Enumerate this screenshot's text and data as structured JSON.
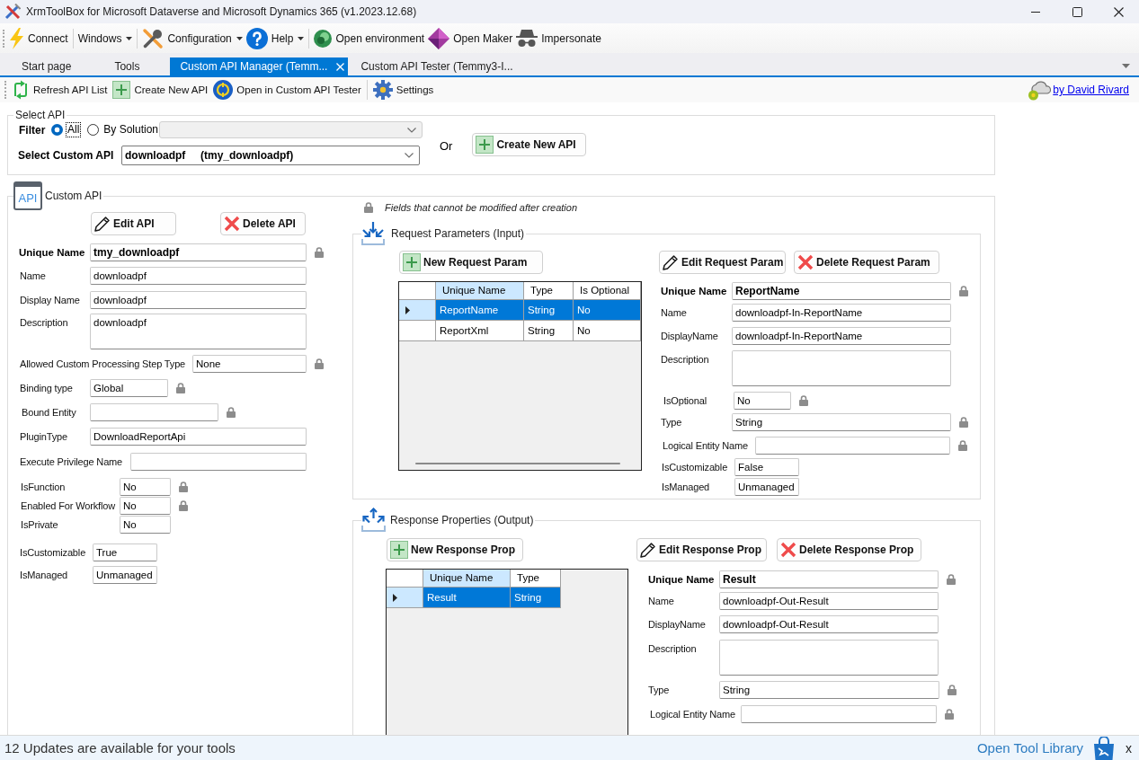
{
  "window": {
    "title": "XrmToolBox for Microsoft Dataverse and Microsoft Dynamics 365 (v1.2023.12.68)"
  },
  "main_toolbar": {
    "groups": [
      {
        "items": [
          {
            "label": "Connect",
            "dropdown": false
          }
        ]
      },
      {
        "items": [
          {
            "label": "Windows",
            "dropdown": true
          }
        ]
      },
      {
        "items": [
          {
            "label": "Configuration",
            "dropdown": true
          },
          {
            "label": "Help",
            "dropdown": true
          }
        ]
      },
      {
        "items": [
          {
            "label": "Open environment",
            "dropdown": false
          },
          {
            "label": "Open Maker",
            "dropdown": false
          },
          {
            "label": "Impersonate",
            "dropdown": false
          }
        ]
      }
    ]
  },
  "tabs": [
    {
      "label": "Start page",
      "selected": false
    },
    {
      "label": "Tools",
      "selected": false
    },
    {
      "label": "Custom API Manager (Temm...",
      "selected": true
    },
    {
      "label": "Custom API Tester (Temmy3-I...",
      "selected": false
    }
  ],
  "tool_toolbar": {
    "groups": [
      {
        "items": [
          {
            "label": "Refresh API List"
          },
          {
            "label": "Create New API"
          },
          {
            "label": "Open in Custom API Tester"
          }
        ]
      },
      {
        "items": [
          {
            "label": "Settings"
          }
        ]
      }
    ],
    "author_link": "by David Rivard"
  },
  "select_api": {
    "title": "Select API",
    "filter_label": "Filter",
    "filter_options": [
      {
        "label": "All",
        "selected": true,
        "focused": true
      },
      {
        "label": "By Solution",
        "selected": false,
        "focused": false
      }
    ],
    "solution_dropdown": {
      "disabled": true
    },
    "custom_api_label": "Select Custom API",
    "custom_api_value": "downloadpf     (tmy_downloadpf)",
    "or_label": "Or",
    "create_button": "Create New API"
  },
  "custom_api": {
    "title": "Custom API",
    "icon_label": "API",
    "edit_button": "Edit API",
    "delete_button": "Delete API",
    "fields": [
      {
        "label": "Unique Name",
        "value": "tmy_downloadpf",
        "kind": "key",
        "locked": true
      },
      {
        "label": "Name",
        "value": "downloadpf",
        "kind": "text",
        "locked": false
      },
      {
        "label": "Display Name",
        "value": "downloadpf",
        "kind": "text",
        "locked": false
      },
      {
        "label": "Description",
        "value": "downloadpf",
        "kind": "multiline",
        "locked": false
      },
      {
        "label": "Allowed Custom Processing Step Type",
        "value": "None",
        "kind": "text",
        "locked": true
      },
      {
        "label": "Binding type",
        "value": "Global",
        "kind": "text",
        "locked": true
      },
      {
        "label": "Bound Entity",
        "kind": "text",
        "locked": true
      },
      {
        "label": "PluginType",
        "value": "DownloadReportApi",
        "kind": "text",
        "locked": false
      },
      {
        "label": "Execute Privilege Name",
        "kind": "text",
        "locked": false
      },
      {
        "label": "IsFunction",
        "value": "No",
        "kind": "text",
        "locked": true
      },
      {
        "label": "Enabled For Workflow",
        "value": "No",
        "kind": "text",
        "locked": true
      },
      {
        "label": "IsPrivate",
        "value": "No",
        "kind": "text",
        "locked": false
      },
      {
        "label": "IsCustomizable",
        "value": "True",
        "kind": "text",
        "locked": false
      },
      {
        "label": "IsManaged",
        "value": "Unmanaged",
        "kind": "text",
        "locked": false
      }
    ]
  },
  "locked_note": "Fields that cannot be modified after creation",
  "request_parameters": {
    "title": "Request Parameters (Input)",
    "new_button": "New Request Param",
    "edit_button": "Edit Request Param",
    "delete_button": "Delete Request Param",
    "table": {
      "columns": [
        {
          "label": "Unique Name",
          "selected": true
        },
        {
          "label": "Type",
          "selected": false
        },
        {
          "label": "Is Optional",
          "selected": false
        }
      ],
      "rows": [
        {
          "cells": [
            "ReportName",
            "String",
            "No"
          ],
          "selected": true
        },
        {
          "cells": [
            "ReportXml",
            "String",
            "No"
          ],
          "selected": false
        }
      ]
    },
    "fields": [
      {
        "label": "Unique Name",
        "value": "ReportName",
        "kind": "key",
        "locked": true
      },
      {
        "label": "Name",
        "value": "downloadpf-In-ReportName",
        "kind": "text",
        "locked": false
      },
      {
        "label": "DisplayName",
        "value": "downloadpf-In-ReportName",
        "kind": "text",
        "locked": false
      },
      {
        "label": "Description",
        "kind": "multiline",
        "locked": false
      },
      {
        "label": "IsOptional",
        "value": "No",
        "kind": "text",
        "locked": true
      },
      {
        "label": "Type",
        "value": "String",
        "kind": "text",
        "locked": true
      },
      {
        "label": "Logical Entity Name",
        "kind": "text",
        "locked": true
      },
      {
        "label": "IsCustomizable",
        "value": "False",
        "kind": "text",
        "locked": false
      },
      {
        "label": "IsManaged",
        "value": "Unmanaged",
        "kind": "text",
        "locked": false
      }
    ]
  },
  "response_properties": {
    "title": "Response Properties (Output)",
    "new_button": "New Response Prop",
    "edit_button": "Edit Response Prop",
    "delete_button": "Delete Response Prop",
    "table": {
      "columns": [
        {
          "label": "Unique Name",
          "selected": true
        },
        {
          "label": "Type",
          "selected": false
        }
      ],
      "rows": [
        {
          "cells": [
            "Result",
            "String"
          ],
          "selected": true
        }
      ]
    },
    "fields": [
      {
        "label": "Unique Name",
        "value": "Result",
        "kind": "key",
        "locked": true
      },
      {
        "label": "Name",
        "value": "downloadpf-Out-Result",
        "kind": "text",
        "locked": false
      },
      {
        "label": "DisplayName",
        "value": "downloadpf-Out-Result",
        "kind": "text",
        "locked": false
      },
      {
        "label": "Description",
        "kind": "multiline",
        "locked": false
      },
      {
        "label": "Type",
        "value": "String",
        "kind": "text",
        "locked": true
      },
      {
        "label": "Logical Entity Name",
        "kind": "text",
        "locked": true
      }
    ]
  },
  "status_bar": {
    "message": "12 Updates are available for your tools",
    "link": "Open Tool Library",
    "close": "x"
  }
}
